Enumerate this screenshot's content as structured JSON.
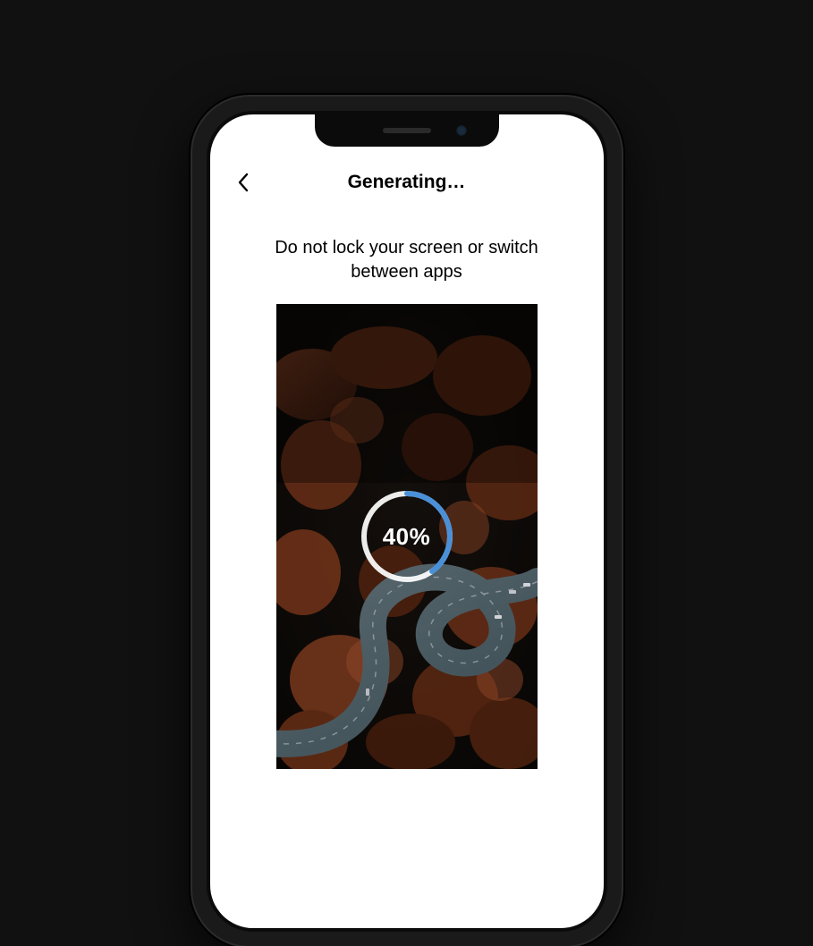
{
  "header": {
    "title": "Generating…",
    "back_icon": "chevron-left-icon"
  },
  "content": {
    "instruction": "Do not lock your screen or switch between apps"
  },
  "progress": {
    "percent": 40,
    "label": "40%"
  },
  "colors": {
    "progress_track": "#ffffff",
    "progress_fill": "#4a90d9",
    "background": "#111111",
    "screen_bg": "#ffffff"
  }
}
